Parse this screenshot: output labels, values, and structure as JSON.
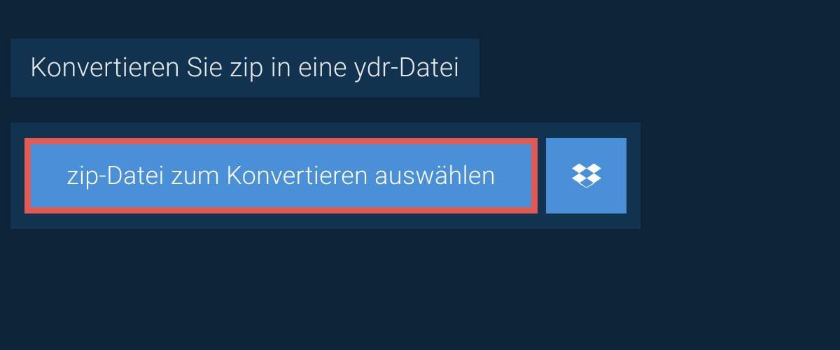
{
  "header": {
    "title": "Konvertieren Sie zip in eine ydr-Datei"
  },
  "actions": {
    "selectFileLabel": "zip-Datei zum Konvertieren auswählen"
  },
  "colors": {
    "background": "#0d2438",
    "panel": "#12334f",
    "buttonPrimary": "#4990d9",
    "buttonBorder": "#e15b54",
    "textLight": "#e8e8e8",
    "textWhite": "#ffffff"
  }
}
